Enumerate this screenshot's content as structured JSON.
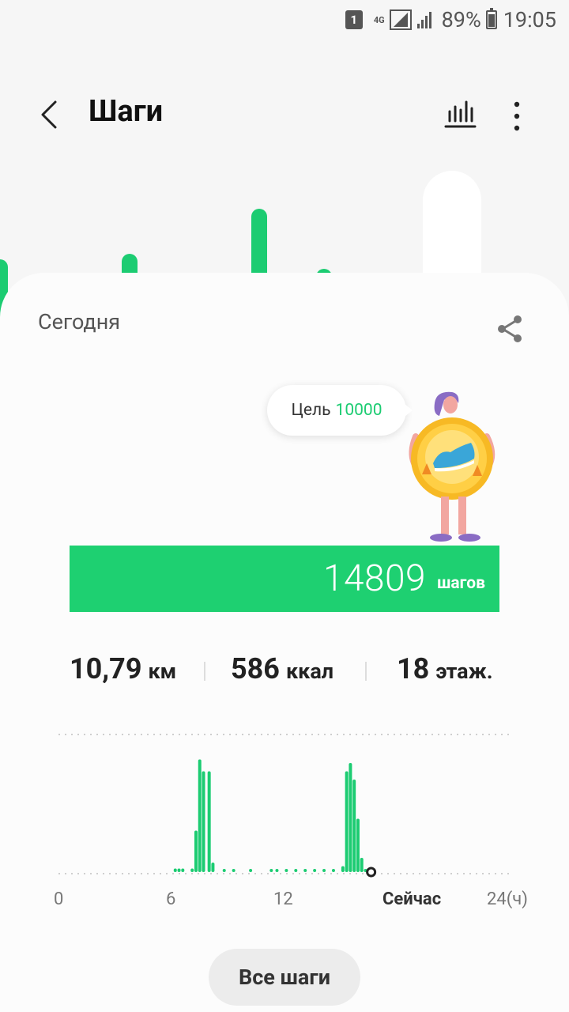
{
  "status_bar": {
    "sim": "1",
    "network": "4G",
    "battery": "89%",
    "time": "19:05"
  },
  "header": {
    "title": "Шаги"
  },
  "week_bars": [
    0.34,
    0.05,
    0.37,
    0.05,
    0.61,
    0.29,
    0.21,
    0.05
  ],
  "card": {
    "today_label": "Сегодня",
    "goal_label": "Цель",
    "goal_value": "10000",
    "steps_value": "14809",
    "steps_unit": "шагов"
  },
  "stats": {
    "distance_value": "10,79",
    "distance_unit": "км",
    "calories_value": "586",
    "calories_unit": "ккал",
    "floors_value": "18",
    "floors_unit": "этаж."
  },
  "hourly_chart": {
    "axis_labels": [
      "0",
      "6",
      "12",
      "Сейчас",
      "24(ч)"
    ],
    "hours": [
      6.2,
      6.4,
      6.6,
      7.1,
      7.3,
      7.5,
      7.7,
      8.0,
      8.2,
      8.8,
      9.3,
      10.2,
      11.3,
      11.6,
      12.1,
      12.6,
      13.1,
      13.6,
      14.1,
      14.6,
      15.1,
      15.3,
      15.5,
      15.7,
      15.9,
      16.1,
      16.3
    ],
    "levels": [
      0.03,
      0.03,
      0.03,
      0.03,
      0.35,
      0.95,
      0.85,
      0.85,
      0.08,
      0.02,
      0.02,
      0.02,
      0.02,
      0.02,
      0.02,
      0.02,
      0.02,
      0.02,
      0.02,
      0.02,
      0.05,
      0.85,
      0.92,
      0.78,
      0.45,
      0.12,
      0.02
    ],
    "now_hour": 16.6
  },
  "buttons": {
    "all_steps": "Все шаги"
  }
}
